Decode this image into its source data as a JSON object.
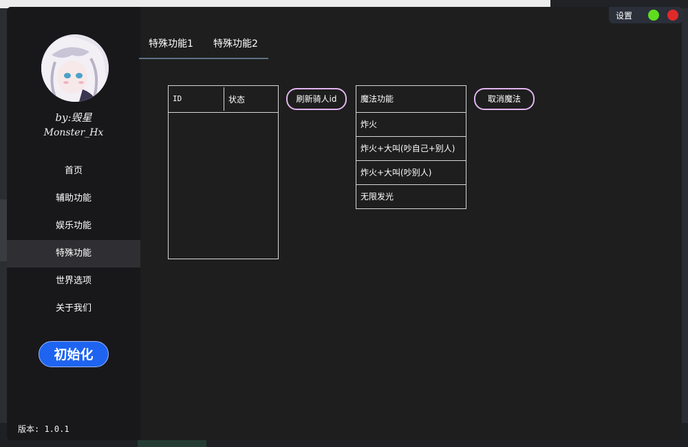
{
  "sidebar": {
    "byline_author": "by:毁星",
    "byline_handle": "Monster_Hx",
    "nav": [
      {
        "label": "首页"
      },
      {
        "label": "辅助功能"
      },
      {
        "label": "娱乐功能"
      },
      {
        "label": "特殊功能",
        "active": true
      },
      {
        "label": "世界选项"
      },
      {
        "label": "关于我们"
      }
    ],
    "init_button": "初始化",
    "version": "版本: 1.0.1"
  },
  "topbar": {
    "settings_label": "设置",
    "status_colors": {
      "green": "#5fdc1f",
      "red": "#e02a2a"
    }
  },
  "tabs": [
    {
      "label": "特殊功能1"
    },
    {
      "label": "特殊功能2"
    }
  ],
  "rider_table": {
    "columns": [
      "ID",
      "状态"
    ],
    "rows": []
  },
  "refresh_button": "刷新骑人id",
  "magic_list": {
    "header": "魔法功能",
    "items": [
      "炸火",
      "炸火+大叫(吵自己+别人)",
      "炸火+大叫(吵别人)",
      "无限发光"
    ]
  },
  "cancel_button": "取消魔法",
  "accent_colors": {
    "primary_button": "#1e64f0",
    "pill_border": "#e3b5f0"
  }
}
